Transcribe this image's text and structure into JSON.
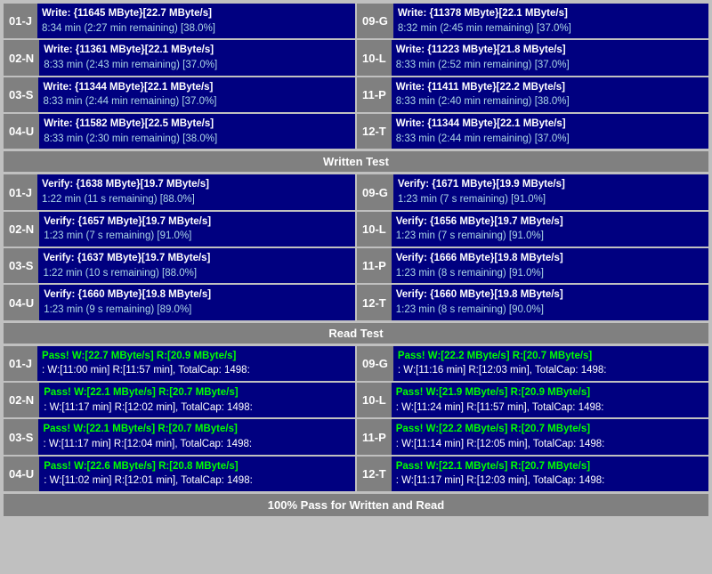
{
  "sections": {
    "write_test": {
      "header": "Written Test",
      "rows": [
        {
          "left": {
            "id": "01-J",
            "line1": "Write: {11645 MByte}[22.7 MByte/s]",
            "line2": "8:34 min (2:27 min remaining)  [38.0%]"
          },
          "right": {
            "id": "09-G",
            "line1": "Write: {11378 MByte}[22.1 MByte/s]",
            "line2": "8:32 min (2:45 min remaining)  [37.0%]"
          }
        },
        {
          "left": {
            "id": "02-N",
            "line1": "Write: {11361 MByte}[22.1 MByte/s]",
            "line2": "8:33 min (2:43 min remaining)  [37.0%]"
          },
          "right": {
            "id": "10-L",
            "line1": "Write: {11223 MByte}[21.8 MByte/s]",
            "line2": "8:33 min (2:52 min remaining)  [37.0%]"
          }
        },
        {
          "left": {
            "id": "03-S",
            "line1": "Write: {11344 MByte}[22.1 MByte/s]",
            "line2": "8:33 min (2:44 min remaining)  [37.0%]"
          },
          "right": {
            "id": "11-P",
            "line1": "Write: {11411 MByte}[22.2 MByte/s]",
            "line2": "8:33 min (2:40 min remaining)  [38.0%]"
          }
        },
        {
          "left": {
            "id": "04-U",
            "line1": "Write: {11582 MByte}[22.5 MByte/s]",
            "line2": "8:33 min (2:30 min remaining)  [38.0%]"
          },
          "right": {
            "id": "12-T",
            "line1": "Write: {11344 MByte}[22.1 MByte/s]",
            "line2": "8:33 min (2:44 min remaining)  [37.0%]"
          }
        }
      ]
    },
    "verify_test": {
      "rows": [
        {
          "left": {
            "id": "01-J",
            "line1": "Verify: {1638 MByte}[19.7 MByte/s]",
            "line2": "1:22 min (11 s remaining)   [88.0%]"
          },
          "right": {
            "id": "09-G",
            "line1": "Verify: {1671 MByte}[19.9 MByte/s]",
            "line2": "1:23 min (7 s remaining)   [91.0%]"
          }
        },
        {
          "left": {
            "id": "02-N",
            "line1": "Verify: {1657 MByte}[19.7 MByte/s]",
            "line2": "1:23 min (7 s remaining)   [91.0%]"
          },
          "right": {
            "id": "10-L",
            "line1": "Verify: {1656 MByte}[19.7 MByte/s]",
            "line2": "1:23 min (7 s remaining)   [91.0%]"
          }
        },
        {
          "left": {
            "id": "03-S",
            "line1": "Verify: {1637 MByte}[19.7 MByte/s]",
            "line2": "1:22 min (10 s remaining)   [88.0%]"
          },
          "right": {
            "id": "11-P",
            "line1": "Verify: {1666 MByte}[19.8 MByte/s]",
            "line2": "1:23 min (8 s remaining)   [91.0%]"
          }
        },
        {
          "left": {
            "id": "04-U",
            "line1": "Verify: {1660 MByte}[19.8 MByte/s]",
            "line2": "1:23 min (9 s remaining)   [89.0%]"
          },
          "right": {
            "id": "12-T",
            "line1": "Verify: {1660 MByte}[19.8 MByte/s]",
            "line2": "1:23 min (8 s remaining)   [90.0%]"
          }
        }
      ]
    },
    "read_test": {
      "header": "Read Test",
      "rows": [
        {
          "left": {
            "id": "01-J",
            "line1": "Pass! W:[22.7 MByte/s] R:[20.9 MByte/s]",
            "line2": ": W:[11:00 min] R:[11:57 min], TotalCap: 1498:"
          },
          "right": {
            "id": "09-G",
            "line1": "Pass! W:[22.2 MByte/s] R:[20.7 MByte/s]",
            "line2": ": W:[11:16 min] R:[12:03 min], TotalCap: 1498:"
          }
        },
        {
          "left": {
            "id": "02-N",
            "line1": "Pass! W:[22.1 MByte/s] R:[20.7 MByte/s]",
            "line2": ": W:[11:17 min] R:[12:02 min], TotalCap: 1498:"
          },
          "right": {
            "id": "10-L",
            "line1": "Pass! W:[21.9 MByte/s] R:[20.9 MByte/s]",
            "line2": ": W:[11:24 min] R:[11:57 min], TotalCap: 1498:"
          }
        },
        {
          "left": {
            "id": "03-S",
            "line1": "Pass! W:[22.1 MByte/s] R:[20.7 MByte/s]",
            "line2": ": W:[11:17 min] R:[12:04 min], TotalCap: 1498:"
          },
          "right": {
            "id": "11-P",
            "line1": "Pass! W:[22.2 MByte/s] R:[20.7 MByte/s]",
            "line2": ": W:[11:14 min] R:[12:05 min], TotalCap: 1498:"
          }
        },
        {
          "left": {
            "id": "04-U",
            "line1": "Pass! W:[22.6 MByte/s] R:[20.8 MByte/s]",
            "line2": ": W:[11:02 min] R:[12:01 min], TotalCap: 1498:"
          },
          "right": {
            "id": "12-T",
            "line1": "Pass! W:[22.1 MByte/s] R:[20.7 MByte/s]",
            "line2": ": W:[11:17 min] R:[12:03 min], TotalCap: 1498:"
          }
        }
      ]
    },
    "footer": "100% Pass for Written and Read"
  }
}
